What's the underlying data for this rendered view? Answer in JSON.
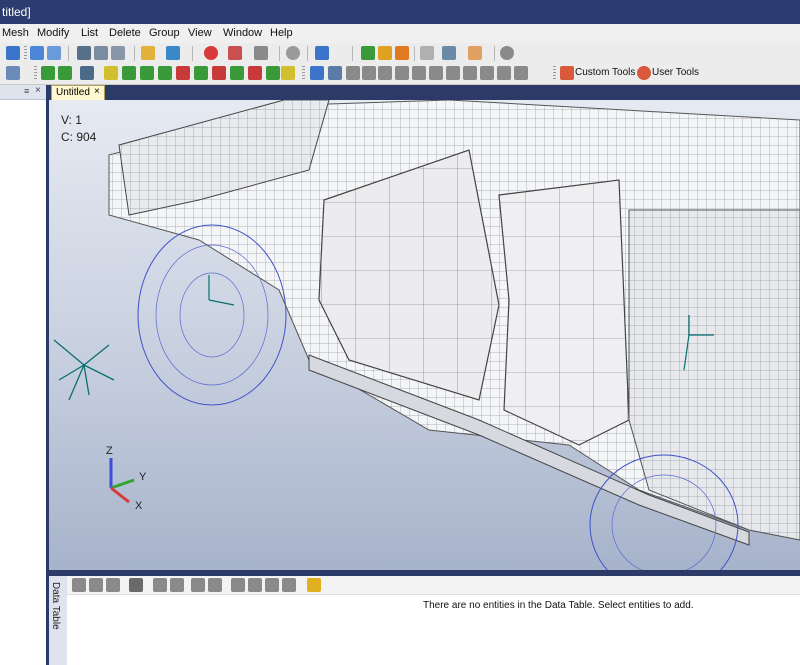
{
  "window": {
    "title": "titled]"
  },
  "menu": [
    "Mesh",
    "Modify",
    "List",
    "Delete",
    "Group",
    "View",
    "Window",
    "Help"
  ],
  "toolbar": {
    "custom_tools": "Custom Tools",
    "user_tools": "User Tools"
  },
  "left_panel": {
    "close": "×",
    "pin": "≡"
  },
  "tabs": [
    {
      "label": "Untitled",
      "close": "×"
    }
  ],
  "viewport": {
    "v_label": "V: 1",
    "c_label": "C: 904",
    "triad": {
      "z": "Z",
      "y": "Y",
      "x": "X"
    }
  },
  "data_table": {
    "side_label": "Data Table",
    "empty_message": "There are no entities in the Data Table. Select entities to add."
  },
  "colors": {
    "background": "#2b3a67",
    "titlebar": "#2c3c70",
    "tab": "#fff8d0"
  }
}
